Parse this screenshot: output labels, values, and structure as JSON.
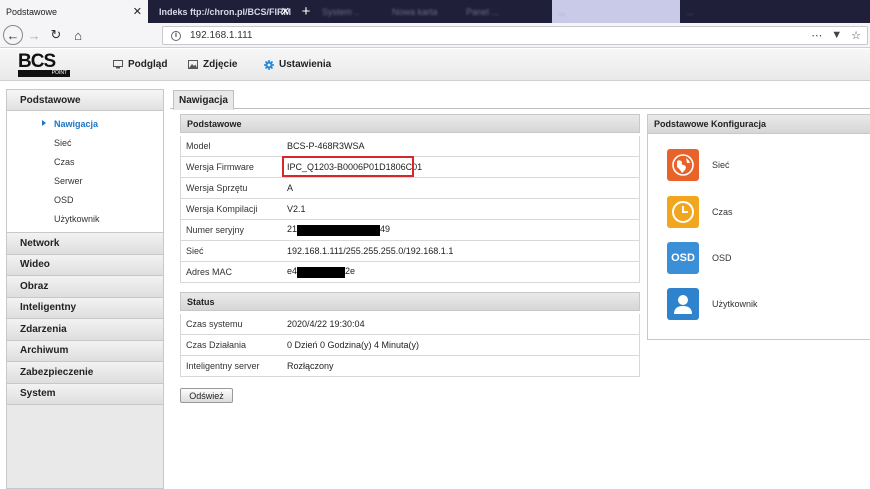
{
  "browser": {
    "tabs": [
      {
        "label": "Podstawowe",
        "close": "✕"
      },
      {
        "label": "Indeks ftp://chron.pl/BCS/FIRM",
        "close": "✕"
      }
    ],
    "blurred_tabs": [
      "System ..",
      "Nowa karta",
      "Panel ...",
      "...",
      "..."
    ],
    "new_tab": "+",
    "url": "192.168.1.111"
  },
  "header": {
    "logo_main": "BCS",
    "logo_sub": "POINT",
    "menu": [
      {
        "label": "Podgląd",
        "icon": "monitor-icon"
      },
      {
        "label": "Zdjęcie",
        "icon": "picture-icon"
      },
      {
        "label": "Ustawienia",
        "icon": "gear-icon"
      }
    ]
  },
  "sidebar": {
    "section": "Podstawowe",
    "sub_items": [
      "Nawigacja",
      "Sieć",
      "Czas",
      "Serwer",
      "OSD",
      "Użytkownik"
    ],
    "selected": "Nawigacja",
    "items": [
      "Network",
      "Wideo",
      "Obraz",
      "Inteligentny",
      "Zdarzenia",
      "Archiwum",
      "Zabezpieczenie",
      "System"
    ]
  },
  "main": {
    "tab": "Nawigacja",
    "basic": {
      "title": "Podstawowe",
      "rows": [
        {
          "label": "Model",
          "value": "BCS-P-468R3WSA"
        },
        {
          "label": "Wersja Firmware",
          "value": "IPC_Q1203-B0006P01D1806C01"
        },
        {
          "label": "Wersja Sprzętu",
          "value": "A"
        },
        {
          "label": "Wersja Kompilacji",
          "value": "V2.1"
        },
        {
          "label": "Numer seryjny",
          "value_prefix": "21",
          "value_suffix": "49"
        },
        {
          "label": "Sieć",
          "value": "192.168.1.111/255.255.255.0/192.168.1.1"
        },
        {
          "label": "Adres MAC",
          "value_prefix": "e4",
          "value_suffix": "2e"
        }
      ]
    },
    "status": {
      "title": "Status",
      "rows": [
        {
          "label": "Czas systemu",
          "value": "2020/4/22 19:30:04"
        },
        {
          "label": "Czas Działania",
          "value": "0 Dzień 0 Godzina(y) 4 Minuta(y)"
        },
        {
          "label": "Inteligentny server",
          "value": "Rozłączony"
        }
      ]
    },
    "refresh_label": "Odśwież"
  },
  "config": {
    "title": "Podstawowe Konfiguracja",
    "items": [
      {
        "label": "Sieć",
        "icon": "network-globe-icon",
        "color": "#e8632a"
      },
      {
        "label": "Czas",
        "icon": "clock-icon",
        "color": "#f2a61e"
      },
      {
        "label": "OSD",
        "icon": "osd-icon",
        "color": "#3b8fd6",
        "text": "OSD"
      },
      {
        "label": "Użytkownik",
        "icon": "user-icon",
        "color": "#2f82cc"
      }
    ]
  }
}
